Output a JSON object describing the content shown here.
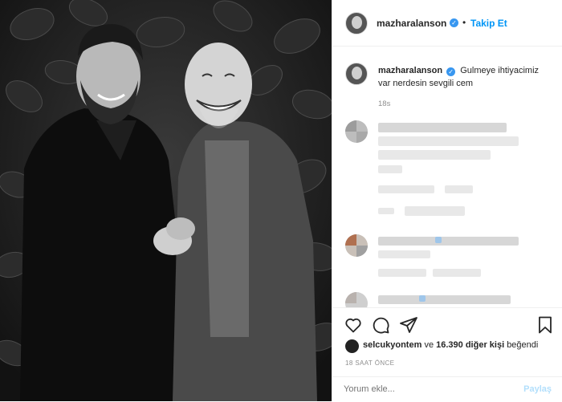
{
  "post": {
    "username": "mazharalanson",
    "follow_label": "Takip Et",
    "dot": "•",
    "verified_mark": "✓"
  },
  "caption": {
    "username": "mazharalanson",
    "text": "Gulmeye ihtiyacimiz var nerdesin sevgili cem",
    "time": "18s"
  },
  "likes": {
    "user": "selcukyontem",
    "connector": "ve",
    "count_text": "16.390 diğer kişi",
    "suffix": "beğendi"
  },
  "timestamp": "18 SAAT ÖNCE",
  "comment_box": {
    "placeholder": "Yorum ekle...",
    "share_label": "Paylaş"
  },
  "icons": {
    "like": "heart-icon",
    "comment": "comment-icon",
    "share": "paper-plane-icon",
    "save": "bookmark-icon"
  },
  "colors": {
    "link_blue": "#0095f6",
    "verified_blue": "#3897f0",
    "muted": "#8e8e8e",
    "text": "#262626"
  }
}
